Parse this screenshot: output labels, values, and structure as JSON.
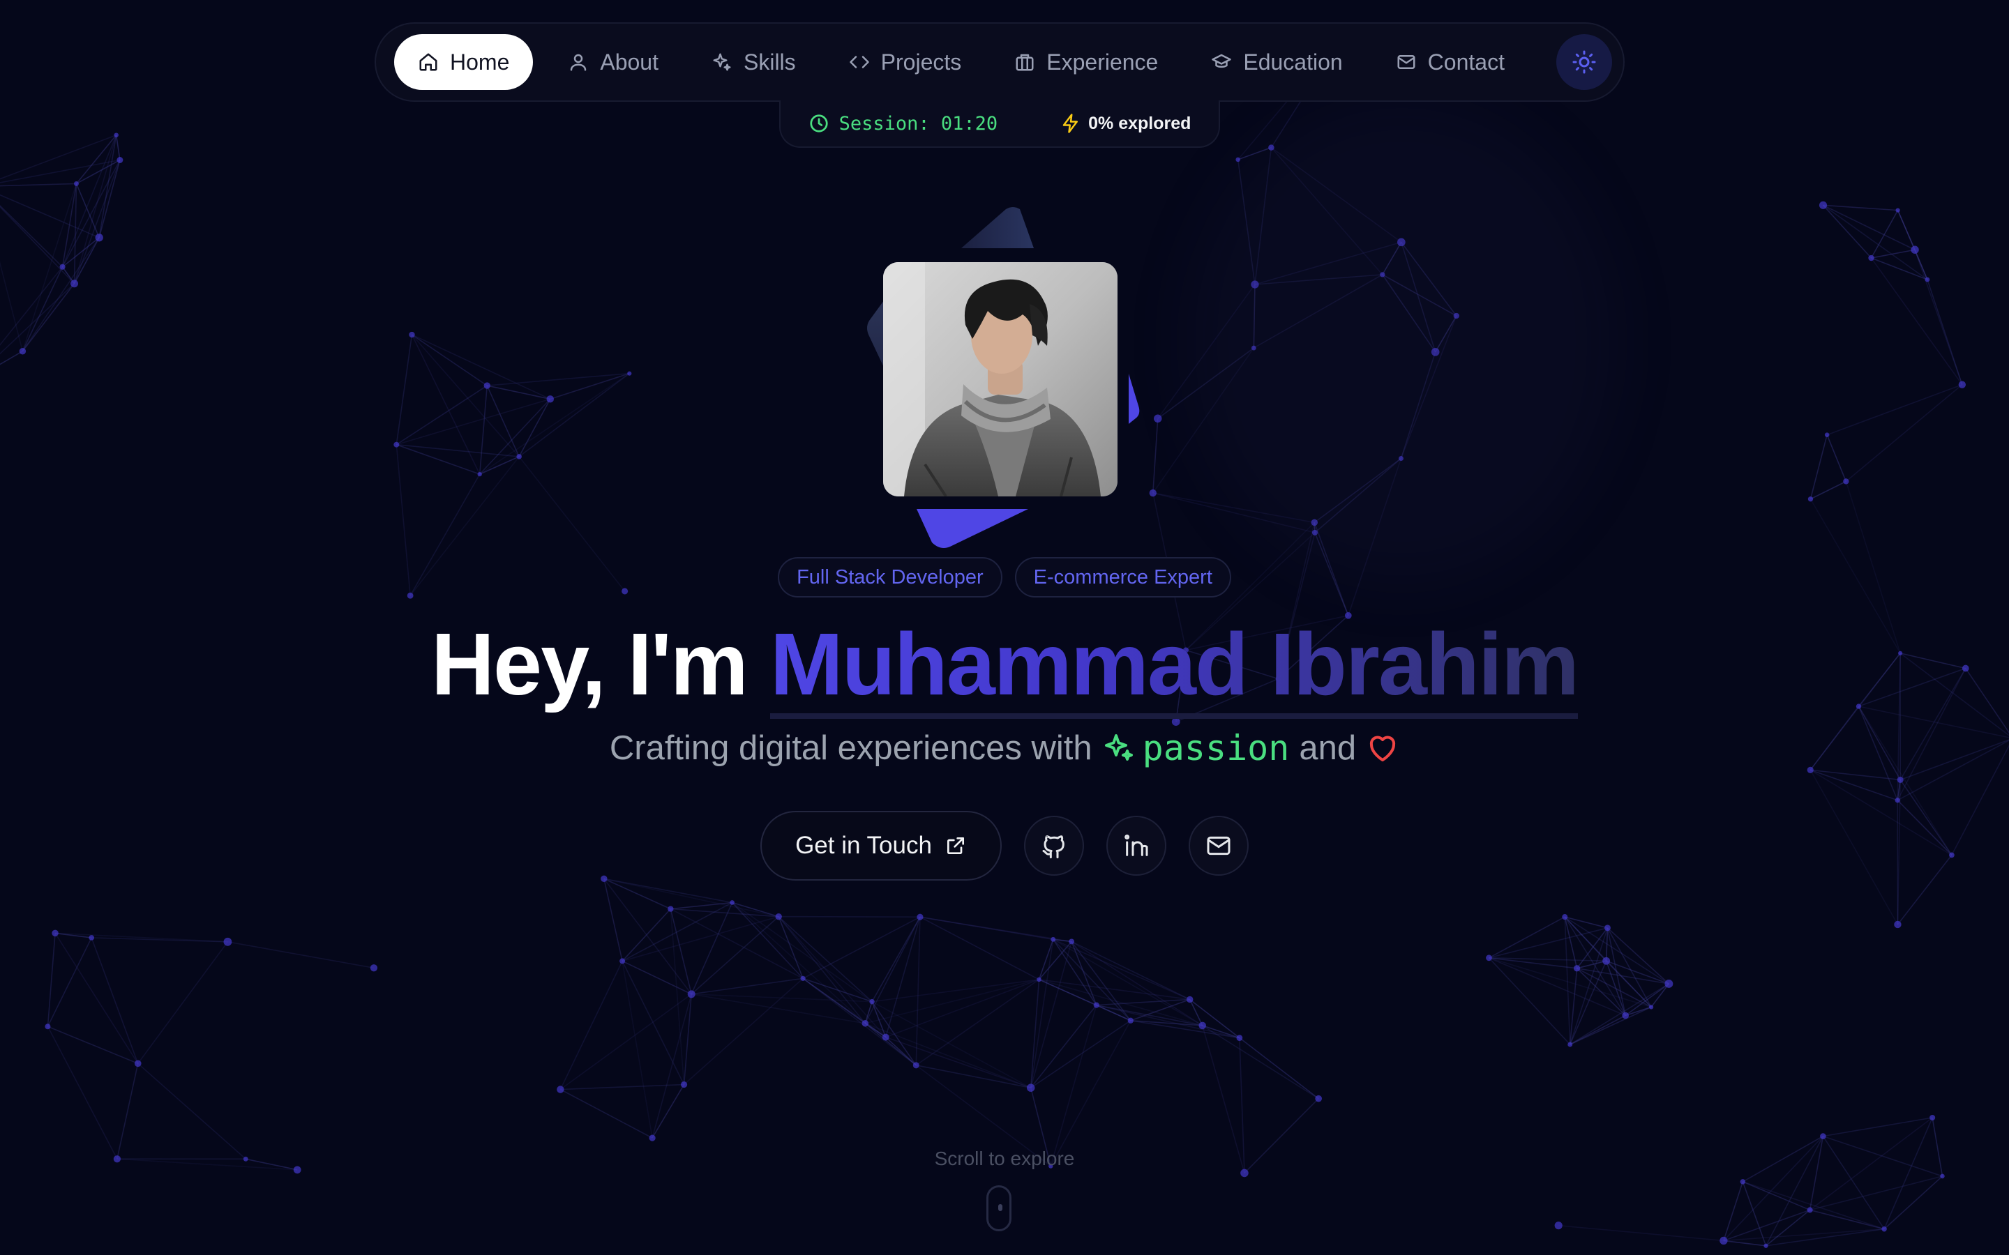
{
  "nav": {
    "items": [
      {
        "label": "Home",
        "icon": "home-icon",
        "active": true
      },
      {
        "label": "About",
        "icon": "user-icon",
        "active": false
      },
      {
        "label": "Skills",
        "icon": "sparkles-icon",
        "active": false
      },
      {
        "label": "Projects",
        "icon": "code-icon",
        "active": false
      },
      {
        "label": "Experience",
        "icon": "briefcase-icon",
        "active": false
      },
      {
        "label": "Education",
        "icon": "graduation-cap-icon",
        "active": false
      },
      {
        "label": "Contact",
        "icon": "mail-icon",
        "active": false
      }
    ],
    "theme_toggle_icon": "sun-icon"
  },
  "session": {
    "timer": "Session: 01:20",
    "explored": "0% explored"
  },
  "tags": [
    "Full Stack Developer",
    "E-commerce Expert"
  ],
  "hero": {
    "greeting": "Hey, I'm ",
    "name": "Muhammad Ibrahim",
    "sub_prefix": "Crafting digital experiences with",
    "sub_highlight": "passion",
    "sub_and": "and"
  },
  "cta": {
    "label": "Get in Touch",
    "socials": [
      "github-icon",
      "linkedin-icon",
      "mail-icon"
    ]
  },
  "scroll_hint": "Scroll to explore",
  "colors": {
    "background": "#05071a",
    "accent": "#4f46e5",
    "terminal_green": "#4ade80",
    "heart": "#ef4444"
  }
}
